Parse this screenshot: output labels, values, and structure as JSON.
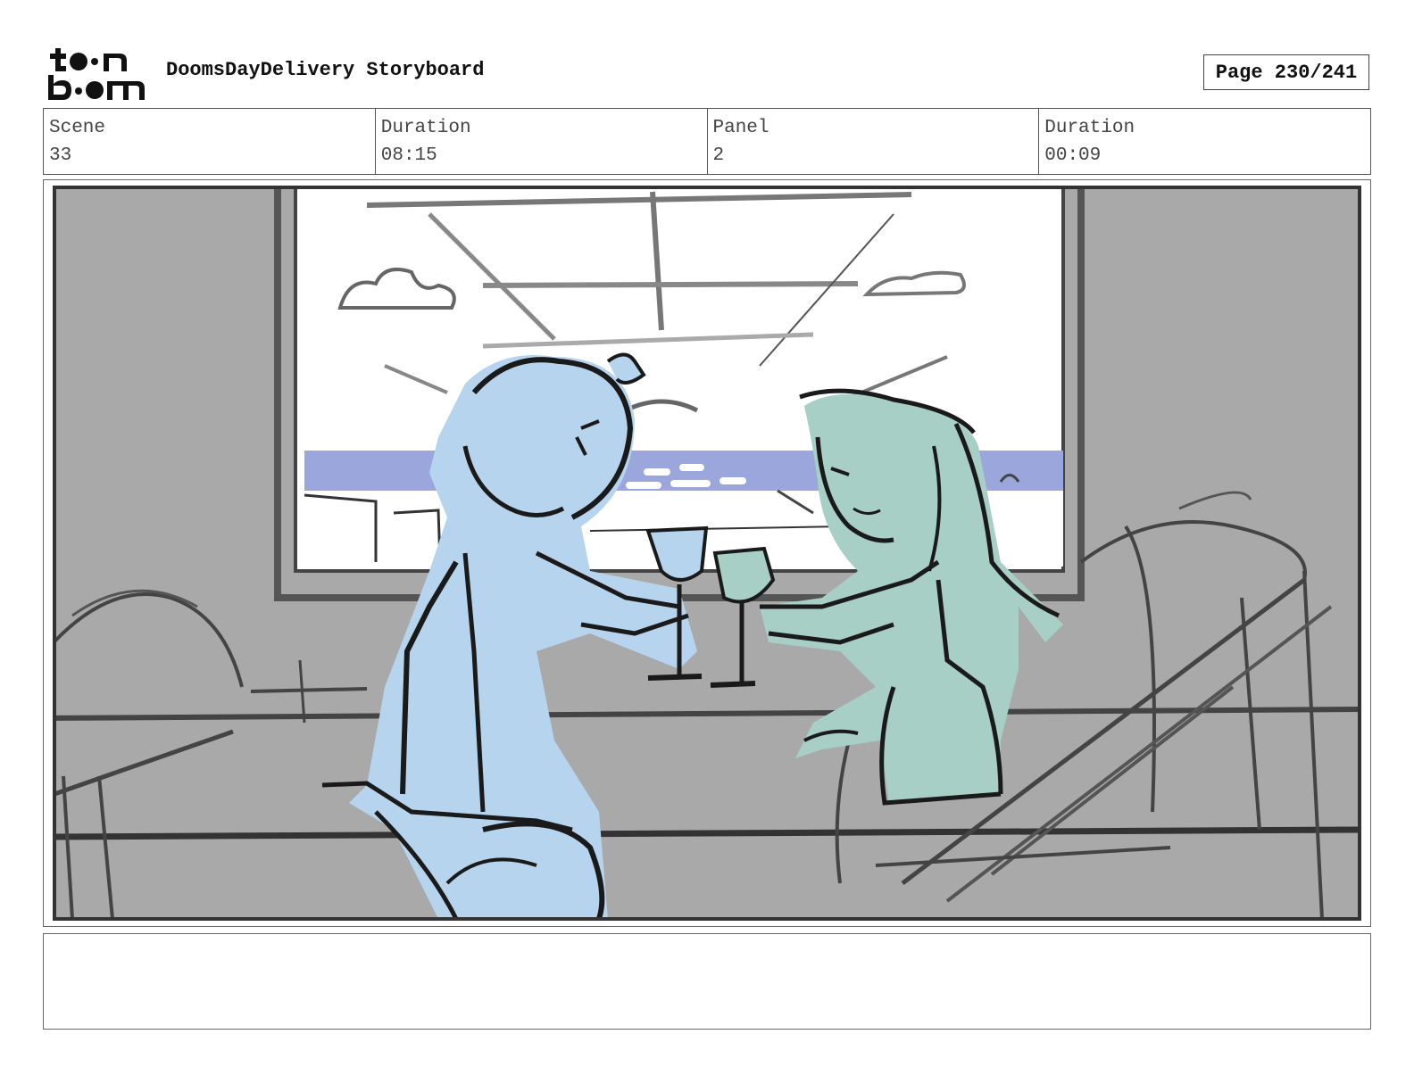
{
  "header": {
    "logo_text_top": "toon",
    "logo_text_bottom": "boom",
    "title": "DoomsDayDelivery Storyboard",
    "page_label": "Page 230/241"
  },
  "info": {
    "scene_label": "Scene",
    "scene_value": "33",
    "scene_duration_label": "Duration",
    "scene_duration_value": "08:15",
    "panel_label": "Panel",
    "panel_value": "2",
    "panel_duration_label": "Duration",
    "panel_duration_value": "00:09"
  },
  "panel": {
    "description": ""
  },
  "notes": {
    "text": ""
  },
  "colors": {
    "background_gray": "#a9a9a9",
    "sea_blue": "#9aa6dc",
    "character_left_blue": "#b7d4ef",
    "character_right_green": "#a8cfc5",
    "ink": "#1a1a1a"
  },
  "icons": {
    "logo": "toonboom-logo"
  }
}
